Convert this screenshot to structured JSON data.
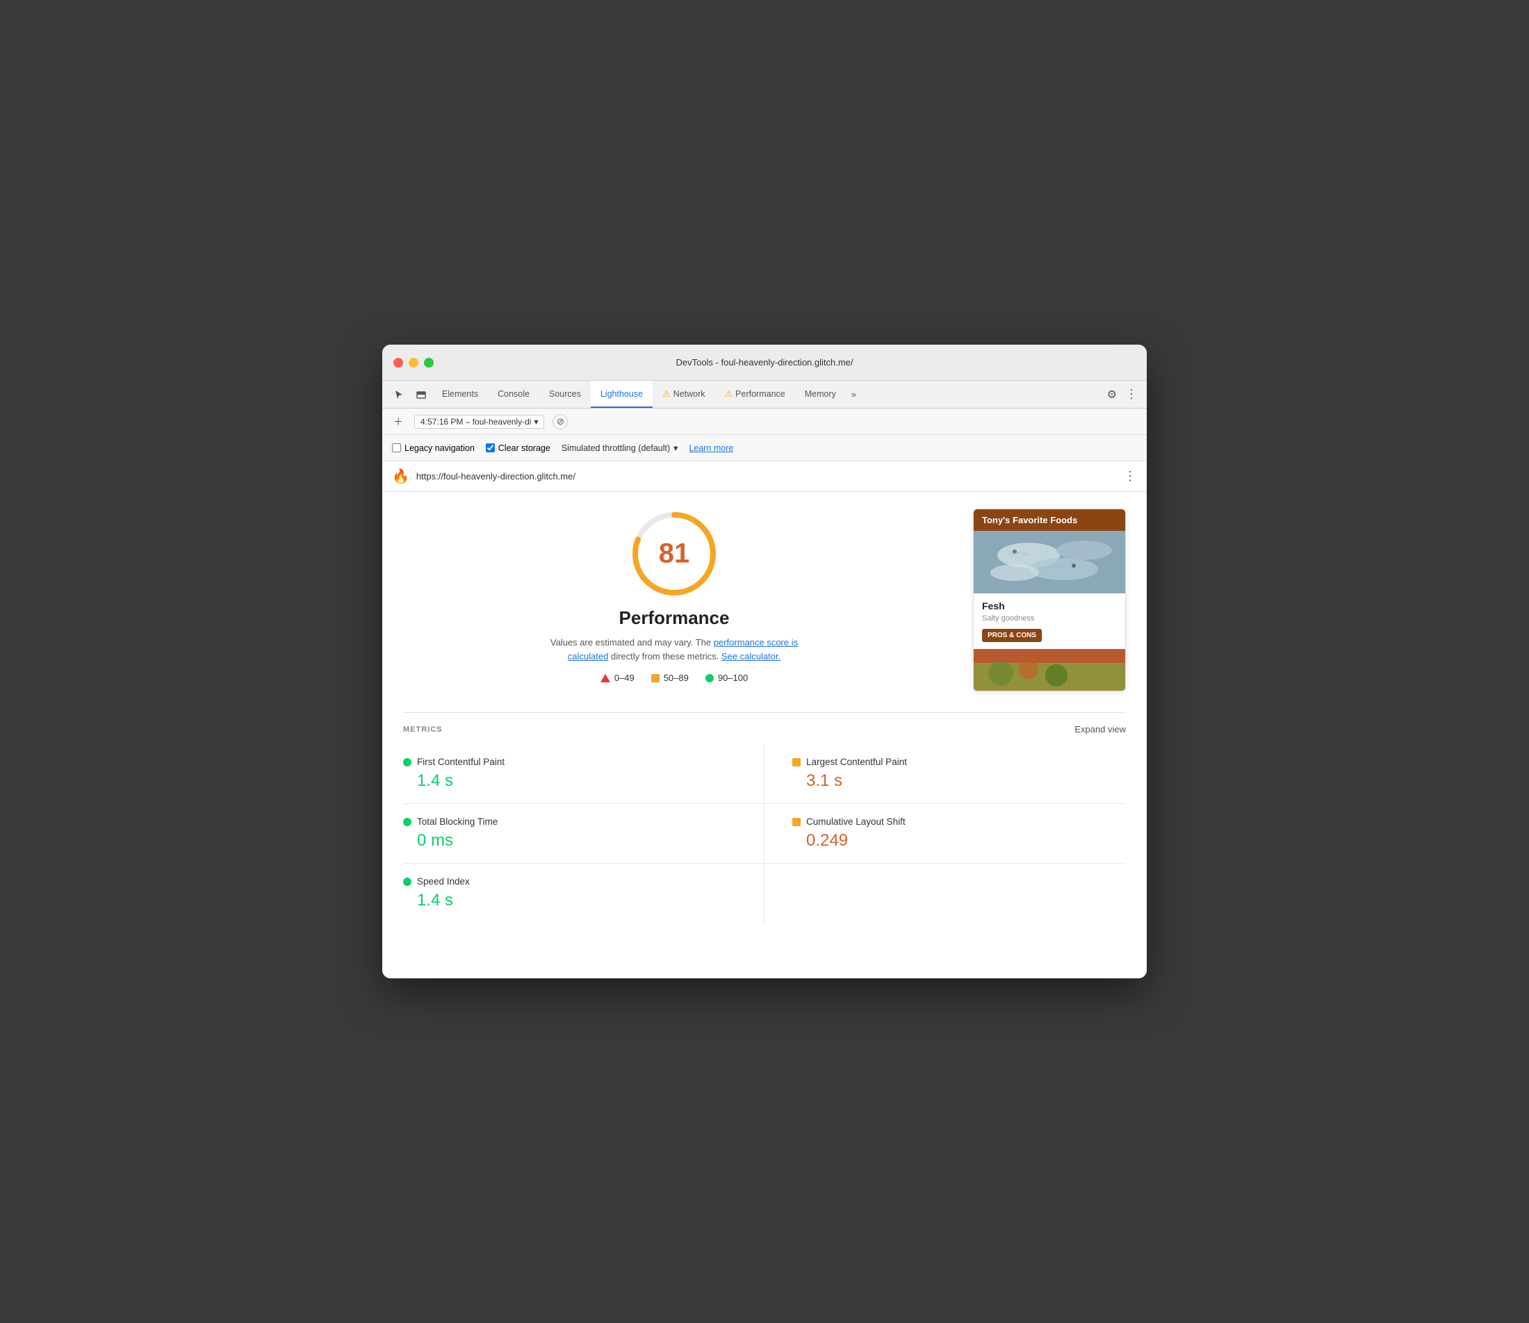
{
  "window": {
    "title": "DevTools - foul-heavenly-direction.glitch.me/"
  },
  "tabs": {
    "elements": "Elements",
    "console": "Console",
    "sources": "Sources",
    "lighthouse": "Lighthouse",
    "network": "Network",
    "performance": "Performance",
    "memory": "Memory",
    "more": "»"
  },
  "toolbar": {
    "session_time": "4:57:16 PM – foul-heavenly-di",
    "session_arrow": "▾"
  },
  "options": {
    "legacy_nav_label": "Legacy navigation",
    "clear_storage_label": "Clear storage",
    "throttle_label": "Simulated throttling (default)",
    "throttle_arrow": "▾",
    "learn_more": "Learn more"
  },
  "url_bar": {
    "url": "https://foul-heavenly-direction.glitch.me/",
    "dots": "⋮"
  },
  "score": {
    "value": "81",
    "title": "Performance",
    "description": "Values are estimated and may vary. The",
    "link1": "performance score is calculated",
    "link2_prefix": "directly from these metrics.",
    "link2": "See calculator.",
    "legend": {
      "range1": "0–49",
      "range2": "50–89",
      "range3": "90–100"
    }
  },
  "preview": {
    "header": "Tony's Favorite Foods",
    "item_name": "Fesh",
    "item_desc": "Salty goodness",
    "btn_label": "PROS & CONS"
  },
  "metrics": {
    "section_label": "METRICS",
    "expand_label": "Expand view",
    "items": [
      {
        "name": "First Contentful Paint",
        "value": "1.4 s",
        "color": "green"
      },
      {
        "name": "Largest Contentful Paint",
        "value": "3.1 s",
        "color": "orange"
      },
      {
        "name": "Total Blocking Time",
        "value": "0 ms",
        "color": "green"
      },
      {
        "name": "Cumulative Layout Shift",
        "value": "0.249",
        "color": "orange"
      },
      {
        "name": "Speed Index",
        "value": "1.4 s",
        "color": "green"
      }
    ]
  }
}
